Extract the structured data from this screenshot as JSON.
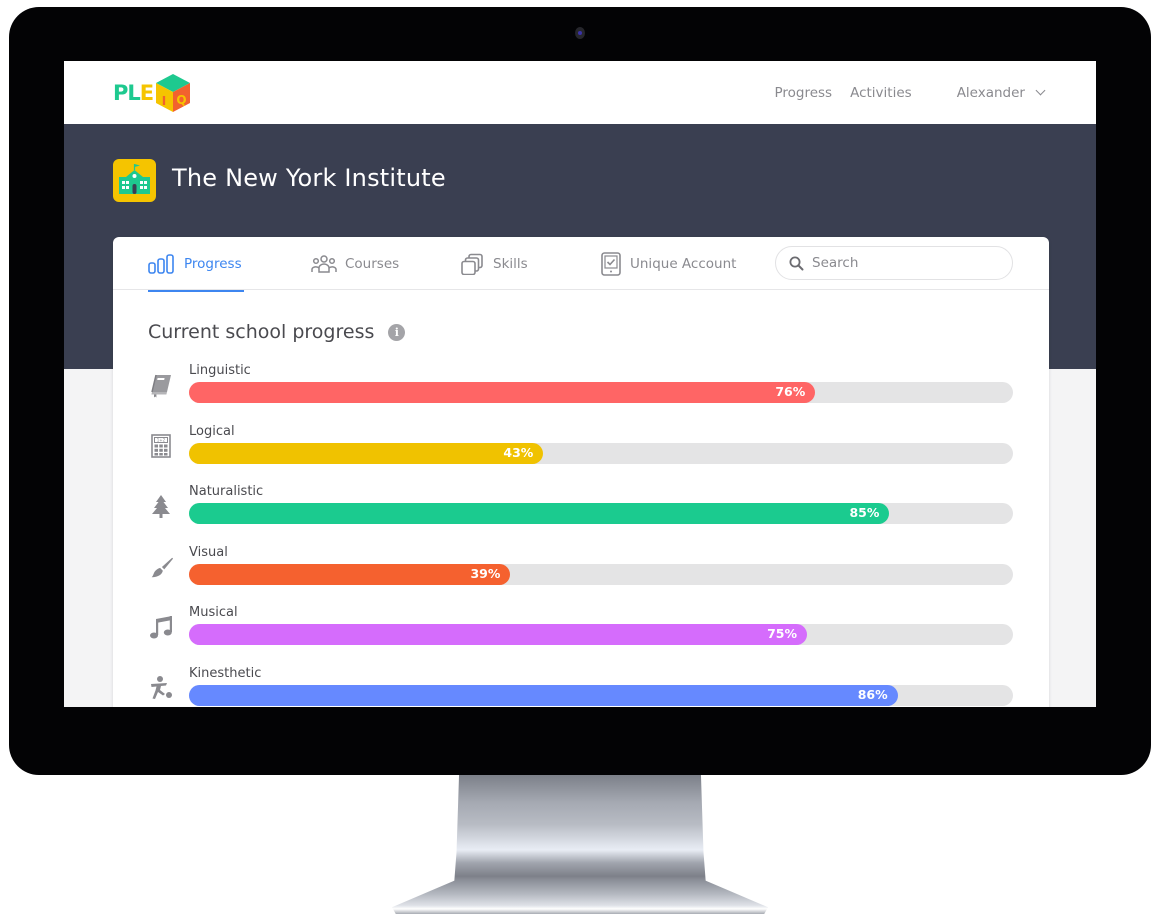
{
  "app": {
    "logo_letters": [
      {
        "char": "P",
        "color": "#1ec98f"
      },
      {
        "char": "L",
        "color": "#1ec98f"
      },
      {
        "char": "E",
        "color": "#f5c400"
      }
    ],
    "logo_cube_letters": [
      "I",
      "Q"
    ],
    "logo_colors": {
      "top": "#1ec98f",
      "left": "#f5c400",
      "right": "#f2622e"
    }
  },
  "topnav": {
    "links": [
      "Progress",
      "Activities"
    ],
    "user_name": "Alexander"
  },
  "hero": {
    "school_name": "The New York Institute"
  },
  "tabs": [
    {
      "label": "Progress",
      "icon": "bar-chart-icon",
      "active": true
    },
    {
      "label": "Courses",
      "icon": "users-icon",
      "active": false
    },
    {
      "label": "Skills",
      "icon": "copy-icon",
      "active": false
    },
    {
      "label": "Unique Account",
      "icon": "tablet-check-icon",
      "active": false
    }
  ],
  "search": {
    "placeholder": "Search",
    "value": ""
  },
  "section": {
    "title": "Current school progress",
    "info_glyph": "i"
  },
  "progress": [
    {
      "label": "Linguistic",
      "icon": "book-icon",
      "percent": 76,
      "text": "76%",
      "color": "#ff6565"
    },
    {
      "label": "Logical",
      "icon": "calculator-icon",
      "percent": 43,
      "text": "43%",
      "color": "#f0c200"
    },
    {
      "label": "Naturalistic",
      "icon": "tree-icon",
      "percent": 85,
      "text": "85%",
      "color": "#1bcb8f"
    },
    {
      "label": "Visual",
      "icon": "paintbrush-icon",
      "percent": 39,
      "text": "39%",
      "color": "#f5612f"
    },
    {
      "label": "Musical",
      "icon": "music-note-icon",
      "percent": 75,
      "text": "75%",
      "color": "#d56cfc"
    },
    {
      "label": "Kinesthetic",
      "icon": "soccer-player-icon",
      "percent": 86,
      "text": "86%",
      "color": "#6689ff"
    }
  ],
  "colors": {
    "accent": "#3d86f0",
    "hero_bg": "#3a3f51",
    "track": "#e4e4e5"
  }
}
